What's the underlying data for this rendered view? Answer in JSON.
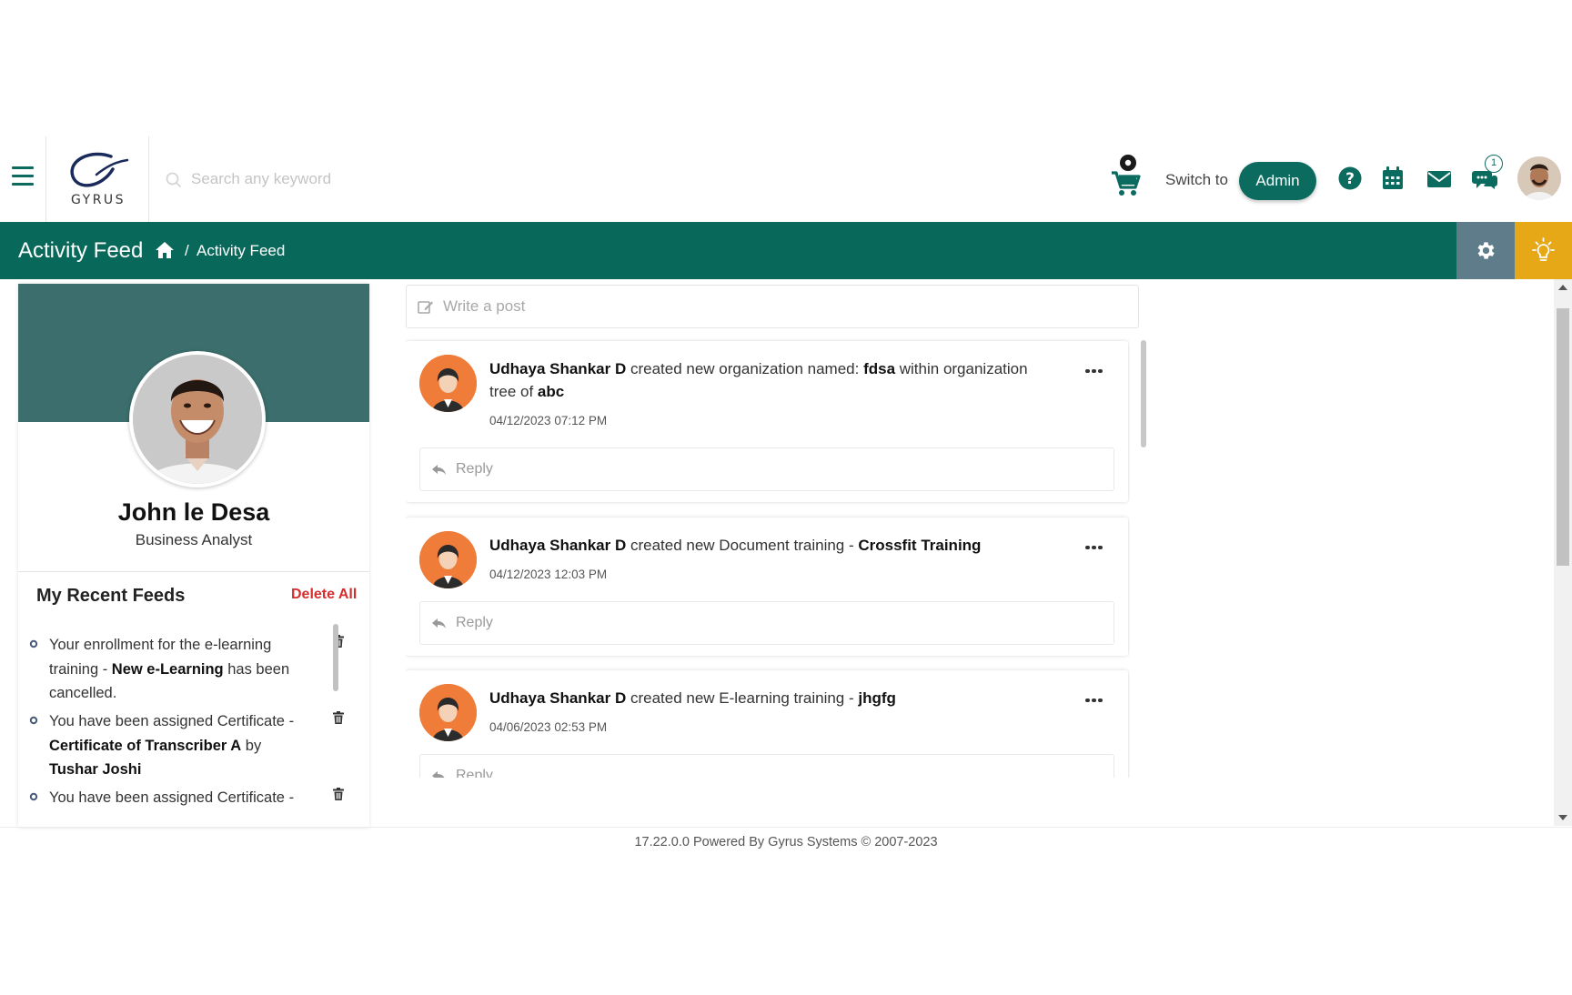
{
  "header": {
    "logo_text": "GYRUS",
    "search_placeholder": "Search any keyword",
    "switch_label": "Switch to",
    "admin_button": "Admin",
    "chat_badge_count": "1",
    "icons": [
      "menu-icon",
      "search-icon",
      "cart-icon",
      "help-icon",
      "calendar-icon",
      "mail-icon",
      "chat-icon",
      "user-avatar"
    ]
  },
  "navbar": {
    "title": "Activity Feed",
    "breadcrumb_separator": "/",
    "breadcrumb_current": "Activity Feed",
    "icons": [
      "home-icon",
      "settings-icon",
      "lightbulb-icon"
    ]
  },
  "profile": {
    "name": "John le Desa",
    "role": "Business Analyst"
  },
  "recent_feeds": {
    "title": "My Recent Feeds",
    "delete_all": "Delete All",
    "items": [
      {
        "t1": "Your enrollment for the e-learning training - ",
        "b1": "New e-Learning",
        "t2": " has been cancelled.",
        "b2": "",
        "t3": ""
      },
      {
        "t1": "You have been assigned Certificate - ",
        "b1": "Certificate of Transcriber A",
        "t2": " by ",
        "b2": "Tushar Joshi",
        "t3": ""
      },
      {
        "t1": "You have been assigned Certificate - ",
        "b1": "",
        "t2": "",
        "b2": "",
        "t3": ""
      }
    ]
  },
  "composer": {
    "placeholder": "Write a post"
  },
  "posts": [
    {
      "author": "Udhaya Shankar D",
      "text1": " created new organization named: ",
      "bold1": "fdsa",
      "text2": " within organization tree of ",
      "bold2": "abc",
      "timestamp": "04/12/2023 07:12 PM",
      "reply_label": "Reply"
    },
    {
      "author": "Udhaya Shankar D",
      "text1": " created new Document training - ",
      "bold1": "Crossfit Training",
      "text2": "",
      "bold2": "",
      "timestamp": "04/12/2023 12:03 PM",
      "reply_label": "Reply"
    },
    {
      "author": "Udhaya Shankar D",
      "text1": " created new E-learning training - ",
      "bold1": "jhgfg",
      "text2": "",
      "bold2": "",
      "timestamp": "04/06/2023 02:53 PM",
      "reply_label": "Reply"
    }
  ],
  "footer": {
    "text": "17.22.0.0 Powered By Gyrus Systems © 2007-2023"
  },
  "colors": {
    "brand_green": "#08685a",
    "delete_red": "#d32f2f",
    "settings_gray": "#5e7c8a",
    "bulb_yellow": "#e6a817"
  }
}
